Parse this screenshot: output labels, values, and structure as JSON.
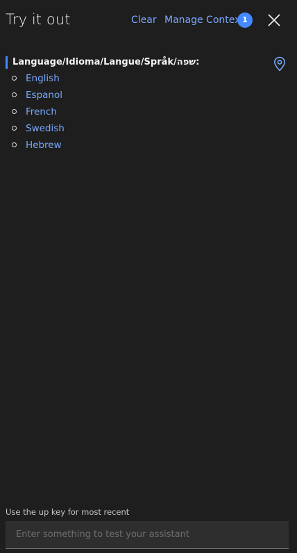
{
  "header": {
    "title": "Try it out",
    "clear_label": "Clear",
    "manage_context_label": "Manage Context",
    "context_count": "1"
  },
  "response": {
    "title": "Language/Idioma/Langue/Språk/שפה:",
    "options": [
      {
        "label": "English"
      },
      {
        "label": "Espanol"
      },
      {
        "label": "French"
      },
      {
        "label": "Swedish"
      },
      {
        "label": "Hebrew"
      }
    ]
  },
  "footer": {
    "hint": "Use the up key for most recent",
    "input_placeholder": "Enter something to test your assistant",
    "input_value": ""
  },
  "colors": {
    "background": "#1e1e1e",
    "link": "#78a9ff",
    "accent": "#4589ff",
    "text": "#f4f4f4"
  },
  "icons": {
    "close": "close-icon",
    "location": "location-pin-icon"
  }
}
